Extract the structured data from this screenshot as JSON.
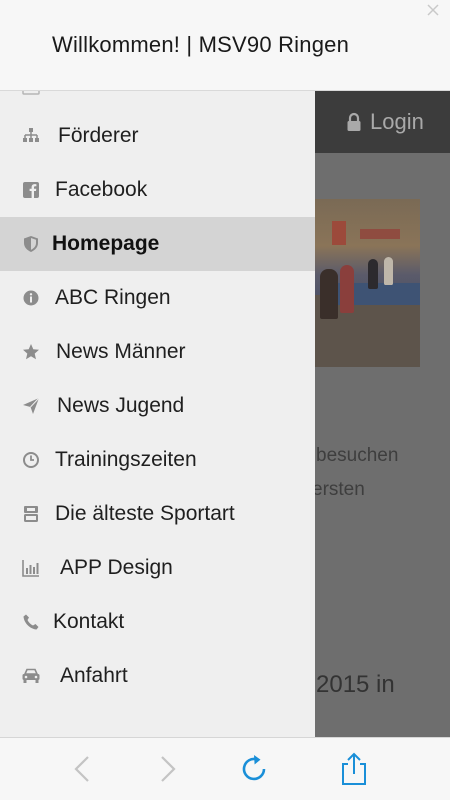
{
  "header": {
    "title": "Willkommen! | MSV90 Ringen"
  },
  "page": {
    "login_label": "Login",
    "text_line1": "besuchen",
    "text_line2": "ersten",
    "text_line3": "2015 in"
  },
  "drawer": {
    "items": [
      {
        "label": "Förderer",
        "icon": "sitemap-icon"
      },
      {
        "label": "Facebook",
        "icon": "facebook-icon"
      },
      {
        "label": "Homepage",
        "icon": "shield-icon",
        "active": true
      },
      {
        "label": "ABC Ringen",
        "icon": "info-icon"
      },
      {
        "label": "News Männer",
        "icon": "star-icon"
      },
      {
        "label": "News Jugend",
        "icon": "paper-plane-icon"
      },
      {
        "label": "Trainingszeiten",
        "icon": "clock-icon"
      },
      {
        "label": "Die älteste Sportart",
        "icon": "youtube-icon"
      },
      {
        "label": "APP Design",
        "icon": "bar-chart-icon"
      },
      {
        "label": "Kontakt",
        "icon": "phone-icon"
      },
      {
        "label": "Anfahrt",
        "icon": "car-icon"
      }
    ]
  },
  "toolbar": {
    "back_icon": "chevron-left-icon",
    "forward_icon": "chevron-right-icon",
    "reload_icon": "reload-icon",
    "share_icon": "share-icon"
  },
  "colors": {
    "accent": "#1a8fd8",
    "drawer_bg": "#efefef",
    "active_bg": "#d4d4d4",
    "icon_gray": "#8c8c8c"
  }
}
